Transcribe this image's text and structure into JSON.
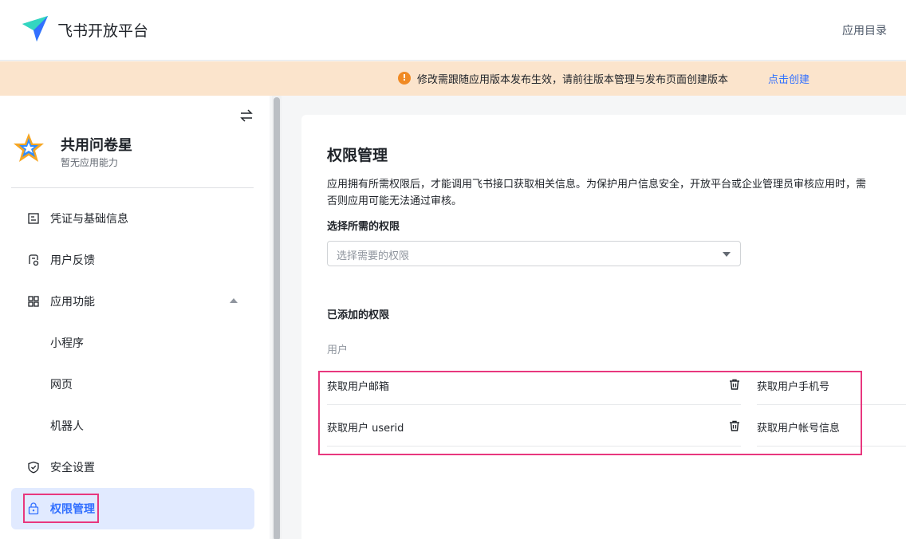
{
  "topbar": {
    "brand": "飞书开放平台",
    "app_directory": "应用目录"
  },
  "notice": {
    "icon": "!",
    "text": "修改需跟随应用版本发布生效，请前往版本管理与发布页面创建版本",
    "link": "点击创建"
  },
  "sidebar": {
    "app_name": "共用问卷星",
    "app_subtitle": "暂无应用能力",
    "items": [
      {
        "label": "凭证与基础信息",
        "icon": "document-icon"
      },
      {
        "label": "用户反馈",
        "icon": "feedback-icon"
      },
      {
        "label": "应用功能",
        "icon": "grid-icon"
      },
      {
        "label": "小程序"
      },
      {
        "label": "网页"
      },
      {
        "label": "机器人"
      },
      {
        "label": "安全设置",
        "icon": "shield-icon"
      },
      {
        "label": "权限管理",
        "icon": "lock-icon",
        "active": true
      }
    ]
  },
  "main": {
    "title": "权限管理",
    "description_line1": "应用拥有所需权限后，才能调用飞书接口获取相关信息。为保护用户信息安全，开放平台或企业管理员审核应用时，需",
    "description_line2": "否则应用可能无法通过审核。",
    "select_label": "选择所需的权限",
    "select_placeholder": "选择需要的权限",
    "added_label": "已添加的权限",
    "group_label": "用户",
    "permissions": [
      {
        "label": "获取用户邮箱"
      },
      {
        "label": "获取用户手机号"
      },
      {
        "label": "获取用户 userid"
      },
      {
        "label": "获取用户帐号信息"
      }
    ]
  },
  "colors": {
    "accent": "#3370ff",
    "highlight": "#e8377e",
    "notice_bg": "#fbe4cc",
    "active_bg": "#e1eaff"
  }
}
